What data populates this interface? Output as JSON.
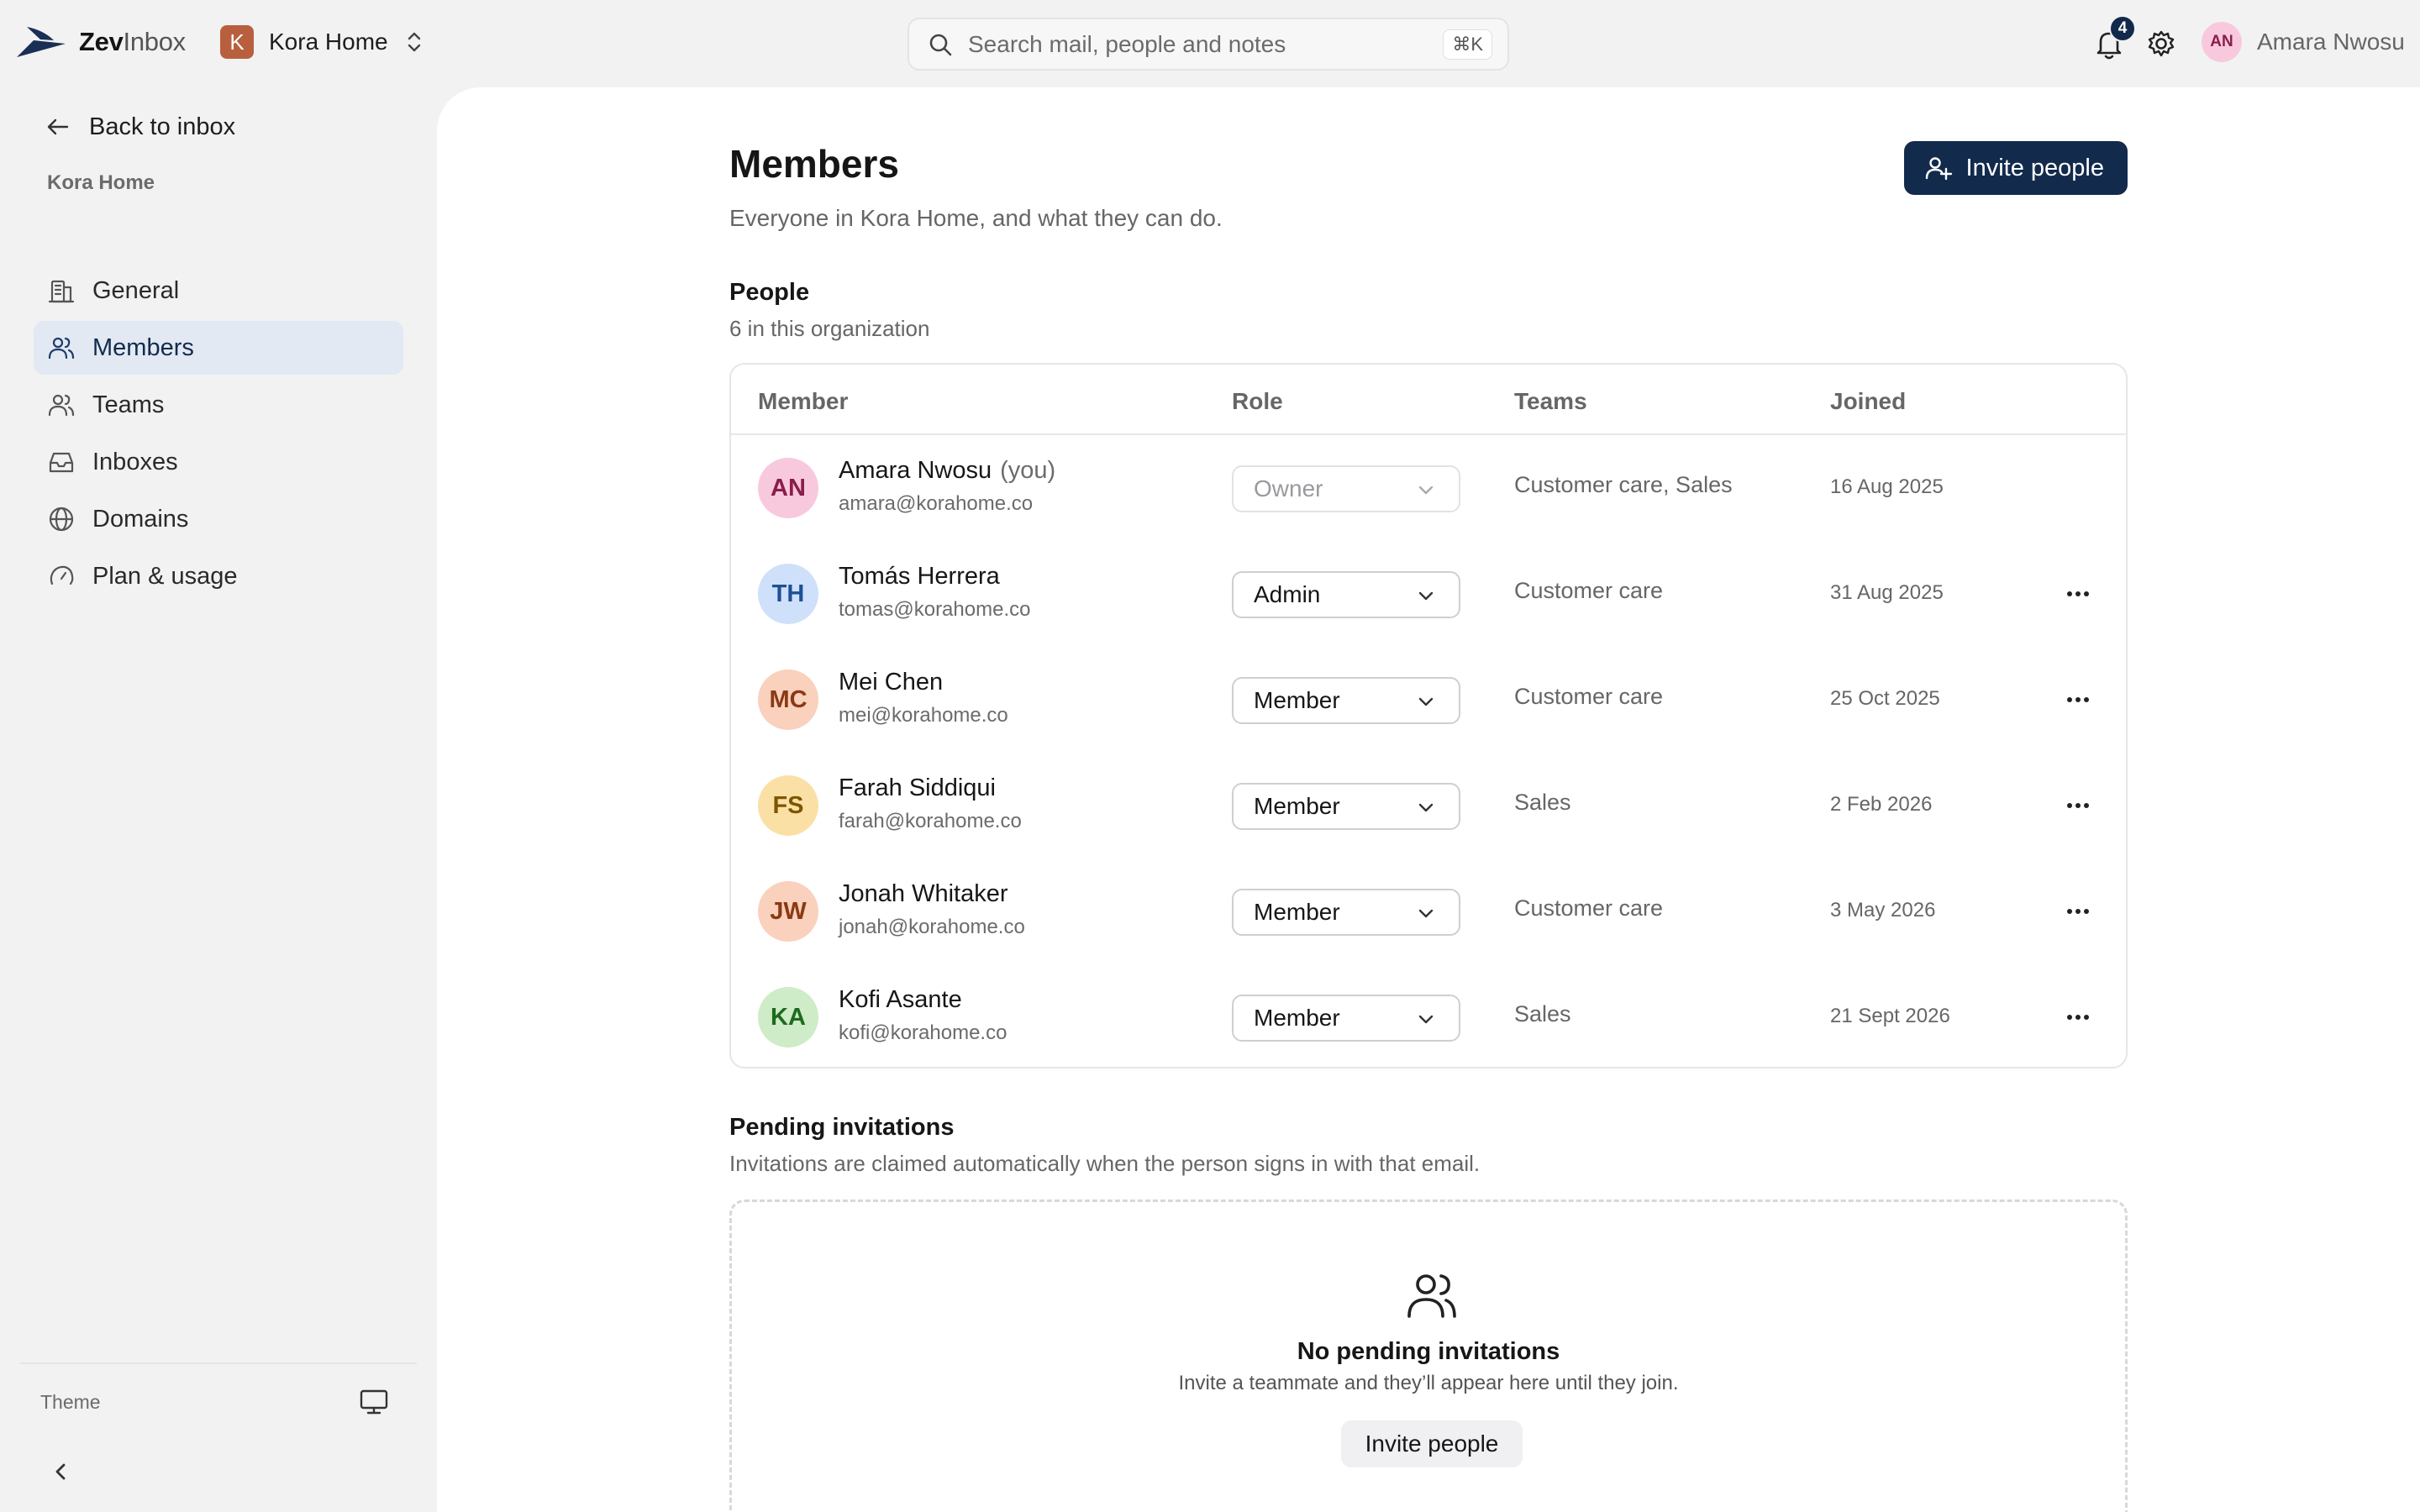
{
  "app": {
    "brand_bold": "Zev",
    "brand_light": "Inbox",
    "workspace_initial": "K",
    "workspace_name": "Kora Home"
  },
  "search": {
    "placeholder": "Search mail, people and notes",
    "shortcut": "⌘K"
  },
  "header": {
    "notification_count": "4",
    "user_initials": "AN",
    "user_name": "Amara Nwosu"
  },
  "sidebar": {
    "back_label": "Back to inbox",
    "section_label": "Kora Home",
    "items": [
      {
        "label": "General",
        "icon": "building-icon",
        "active": false
      },
      {
        "label": "Members",
        "icon": "members-icon",
        "active": true
      },
      {
        "label": "Teams",
        "icon": "teams-icon",
        "active": false
      },
      {
        "label": "Inboxes",
        "icon": "inbox-icon",
        "active": false
      },
      {
        "label": "Domains",
        "icon": "globe-icon",
        "active": false
      },
      {
        "label": "Plan & usage",
        "icon": "gauge-icon",
        "active": false
      }
    ],
    "theme_label": "Theme"
  },
  "page": {
    "title": "Members",
    "subtitle": "Everyone in Kora Home, and what they can do.",
    "invite_button": "Invite people"
  },
  "people": {
    "title": "People",
    "count_text": "6 in this organization",
    "columns": [
      "Member",
      "Role",
      "Teams",
      "Joined"
    ],
    "members": [
      {
        "initials": "AN",
        "name": "Amara Nwosu",
        "you": "(you)",
        "email": "amara@korahome.co",
        "role": "Owner",
        "teams": "Customer care, Sales",
        "joined": "16 Aug 2025",
        "avatar_bg": "#f8c9dd",
        "avatar_fg": "#8a1d4c"
      },
      {
        "initials": "TH",
        "name": "Tomás Herrera",
        "you": "",
        "email": "tomas@korahome.co",
        "role": "Admin",
        "teams": "Customer care",
        "joined": "31 Aug 2025",
        "avatar_bg": "#cfe0fb",
        "avatar_fg": "#1e4f96"
      },
      {
        "initials": "MC",
        "name": "Mei Chen",
        "you": "",
        "email": "mei@korahome.co",
        "role": "Member",
        "teams": "Customer care",
        "joined": "25 Oct 2025",
        "avatar_bg": "#f9d1bd",
        "avatar_fg": "#8a3a14"
      },
      {
        "initials": "FS",
        "name": "Farah Siddiqui",
        "you": "",
        "email": "farah@korahome.co",
        "role": "Member",
        "teams": "Sales",
        "joined": "2 Feb 2026",
        "avatar_bg": "#fbe0a6",
        "avatar_fg": "#7d5600"
      },
      {
        "initials": "JW",
        "name": "Jonah Whitaker",
        "you": "",
        "email": "jonah@korahome.co",
        "role": "Member",
        "teams": "Customer care",
        "joined": "3 May 2026",
        "avatar_bg": "#f9d1bd",
        "avatar_fg": "#8a3a14"
      },
      {
        "initials": "KA",
        "name": "Kofi Asante",
        "you": "",
        "email": "kofi@korahome.co",
        "role": "Member",
        "teams": "Sales",
        "joined": "21 Sept 2026",
        "avatar_bg": "#cdecc7",
        "avatar_fg": "#1f6a1c"
      }
    ]
  },
  "pending": {
    "title": "Pending invitations",
    "subtitle": "Invitations are claimed automatically when the person signs in with that email.",
    "empty_title": "No pending invitations",
    "empty_subtitle": "Invite a teammate and they’ll appear here until they join.",
    "empty_button": "Invite people"
  },
  "colors": {
    "accent": "#122a4c",
    "active_nav_bg": "#e2e9f3",
    "workspace_badge": "#b8603e"
  }
}
